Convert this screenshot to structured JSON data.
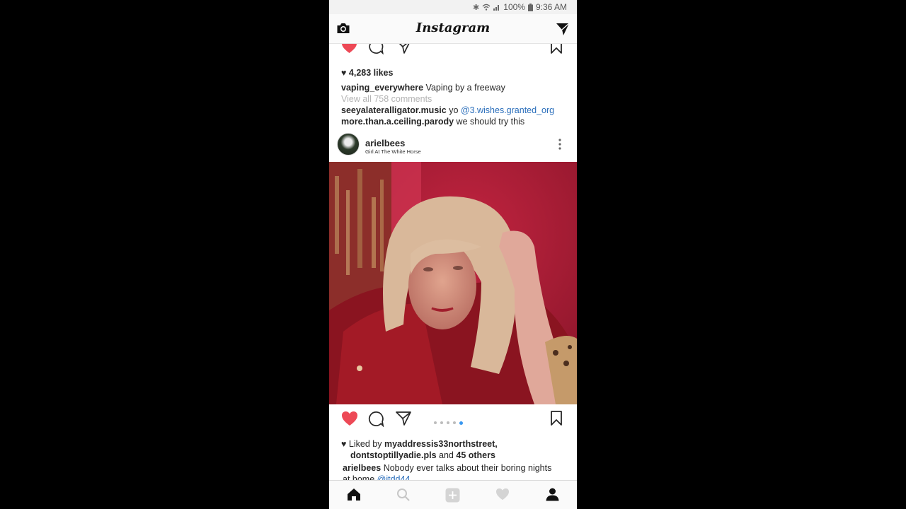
{
  "status_bar": {
    "battery": "100%",
    "time": "9:36 AM",
    "icons": [
      "bluetooth-icon",
      "wifi-icon",
      "signal-icon",
      "battery-icon"
    ]
  },
  "header": {
    "title": "Instagram",
    "left_icon": "camera-icon",
    "right_icon": "direct-message-icon"
  },
  "prev_post": {
    "likes": "4,283 likes",
    "caption_user": "vaping_everywhere",
    "caption_text": "Vaping by a freeway",
    "view_comments": "View all 758 comments",
    "comments": [
      {
        "user": "seeyalateralligator.music",
        "text": "yo",
        "mention": "@3.wishes.granted_org"
      },
      {
        "user": "more.than.a.ceiling.parody",
        "text": " we should try this"
      }
    ]
  },
  "post": {
    "username": "arielbees",
    "location": "Girl At The White Horse",
    "liked_by_prefix": "Liked by",
    "liked_by_user1": "myaddressis33northstreet,",
    "liked_by_user2": "dontstoptillyadie.pls",
    "liked_by_and": "and",
    "liked_by_others": "45 others",
    "caption_user": "arielbees",
    "caption_line1": "Nobody ever talks about their boring nights",
    "caption_line2": "at home",
    "caption_mention": "@itdd44",
    "carousel": {
      "count": 5,
      "active_index": 5
    }
  },
  "bottom_nav": [
    "home-icon",
    "search-icon",
    "add-post-icon",
    "activity-heart-icon",
    "profile-icon"
  ],
  "colors": {
    "like": "#ed4956",
    "link": "#2a6ebb",
    "carousel_active": "#3897f0"
  }
}
